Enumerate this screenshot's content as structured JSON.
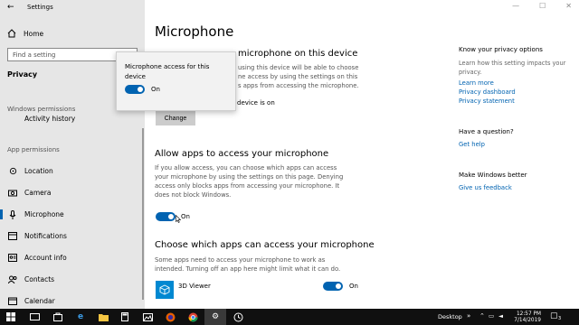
{
  "window": {
    "title": "Settings",
    "controls": [
      "—",
      "☐",
      "✕"
    ]
  },
  "sidebar": {
    "home": "Home",
    "search_placeholder": "Find a setting",
    "category": "Privacy",
    "windows_permissions_heading": "Windows permissions",
    "windows_permissions_items": [
      {
        "label": "Activity history",
        "icon": "history-icon"
      }
    ],
    "app_permissions_heading": "App permissions",
    "items": [
      {
        "label": "Location",
        "icon": "location-icon"
      },
      {
        "label": "Camera",
        "icon": "camera-icon"
      },
      {
        "label": "Microphone",
        "icon": "microphone-icon",
        "active": true
      },
      {
        "label": "Notifications",
        "icon": "notifications-icon"
      },
      {
        "label": "Account info",
        "icon": "account-info-icon"
      },
      {
        "label": "Contacts",
        "icon": "contacts-icon"
      },
      {
        "label": "Calendar",
        "icon": "calendar-icon"
      }
    ]
  },
  "main": {
    "title": "Microphone",
    "section1": {
      "heading_visible": "microphone on this device",
      "desc_lines": [
        "using this device will be able to choose",
        "ne access by using the settings on this",
        "s apps from accessing the microphone."
      ],
      "status_visible": "device is on",
      "change_button": "Change"
    },
    "section2": {
      "heading": "Allow apps to access your microphone",
      "desc": "If you allow access, you can choose which apps can access your microphone by using the settings on this page. Denying access only blocks apps from accessing your microphone. It does not block Windows.",
      "toggle_label": "On",
      "toggle_on": true
    },
    "section3": {
      "heading": "Choose which apps can access your microphone",
      "desc": "Some apps need to access your microphone to work as intended. Turning off an app here might limit what it can do.",
      "apps": [
        {
          "name": "3D Viewer",
          "toggle_label": "On",
          "toggle_on": true
        }
      ]
    }
  },
  "popup": {
    "title": "Microphone access for this device",
    "toggle_label": "On",
    "toggle_on": true
  },
  "right": {
    "privacy_heading": "Know your privacy options",
    "privacy_desc": "Learn how this setting impacts your privacy.",
    "links": [
      "Learn more",
      "Privacy dashboard",
      "Privacy statement"
    ],
    "question_heading": "Have a question?",
    "help_link": "Get help",
    "better_heading": "Make Windows better",
    "feedback_link": "Give us feedback"
  },
  "taskbar": {
    "desktop_label": "Desktop",
    "time": "12:57 PM",
    "date": "7/14/2019",
    "notification_count": "3",
    "accent": "#0063b1"
  }
}
